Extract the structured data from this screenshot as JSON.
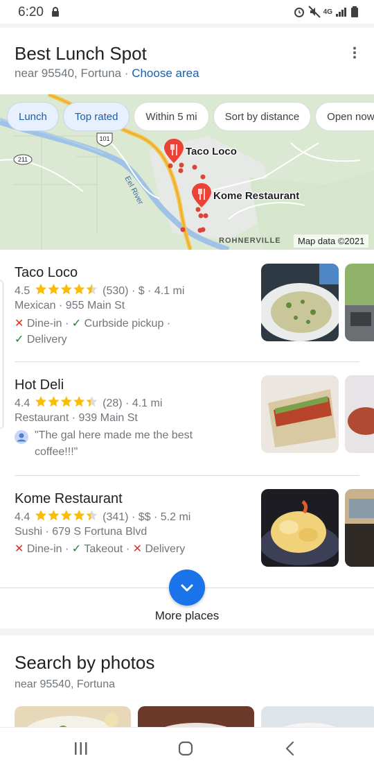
{
  "status_bar": {
    "time": "6:20",
    "network": "4G"
  },
  "header": {
    "title": "Best Lunch Spot",
    "location": "near 95540, Fortuna ·",
    "choose_area": "Choose area"
  },
  "filters": [
    "Lunch",
    "Top rated",
    "Within 5 mi",
    "Sort by distance",
    "Open now"
  ],
  "map": {
    "pins": [
      "Taco Loco",
      "Kome Restaurant"
    ],
    "river_label": "Eel River",
    "town_label": "ROHNERVILLE",
    "attribution": "Map data ©2021",
    "shields": [
      "101",
      "211"
    ]
  },
  "listings": [
    {
      "name": "Taco Loco",
      "rating": "4.5",
      "stars": 4.5,
      "reviews": "(530)",
      "details": "· $ · 4.1 mi",
      "category_address": "Mexican · 955 Main St",
      "services_line1": [
        {
          "label": "Dine-in",
          "available": false,
          "sep": " · "
        },
        {
          "label": "Curbside pickup",
          "available": true,
          "sep": " ·"
        }
      ],
      "services_line2": [
        {
          "label": "Delivery",
          "available": true,
          "sep": ""
        }
      ]
    },
    {
      "name": "Hot Deli",
      "rating": "4.4",
      "stars": 4.4,
      "reviews": "(28)",
      "details": "· 4.1 mi",
      "category_address": "Restaurant · 939 Main St",
      "review_snippet_line1": "\"The gal here made me the best",
      "review_snippet_line2": "coffee!!!\""
    },
    {
      "name": "Kome Restaurant",
      "rating": "4.4",
      "stars": 4.4,
      "reviews": "(341)",
      "details": "· $$ · 5.2 mi",
      "category_address": "Sushi · 679 S Fortuna Blvd",
      "services_line1": [
        {
          "label": "Dine-in",
          "available": false,
          "sep": " · "
        },
        {
          "label": "Takeout",
          "available": true,
          "sep": " · "
        },
        {
          "label": "Delivery",
          "available": false,
          "sep": ""
        }
      ]
    }
  ],
  "more_places": "More places",
  "search_by_photos": {
    "title": "Search by photos",
    "subtitle": "near 95540, Fortuna"
  },
  "colors": {
    "accent": "#1a73e8",
    "link": "#1a5ea8",
    "star": "#fbbc04",
    "available": "#188038",
    "unavailable": "#d93025"
  }
}
